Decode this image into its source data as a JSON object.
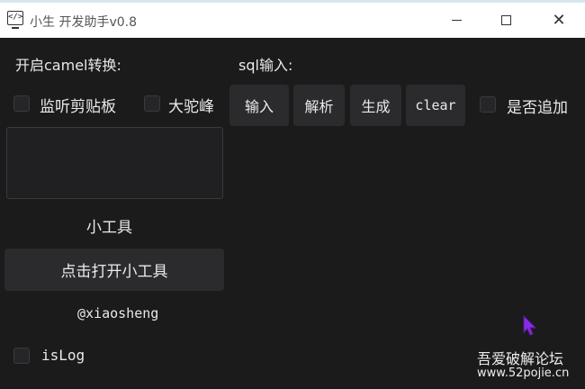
{
  "window": {
    "title": "小生 开发助手v0.8",
    "icon_glyph": "</>"
  },
  "left": {
    "camel_label": "开启camel转换:",
    "clipboard_checkbox_label": "监听剪贴板",
    "bigcamel_checkbox_label": "大驼峰",
    "tools_label": "小工具",
    "open_tools_button": "点击打开小工具",
    "author": "@xiaosheng",
    "islog_label": "isLog"
  },
  "sql": {
    "label": "sql输入:",
    "buttons": [
      "输入",
      "解析",
      "生成",
      "clear"
    ],
    "append_label": "是否追加"
  },
  "watermark": {
    "line1": "吾爱破解论坛",
    "line2": "www.52pojie.cn"
  },
  "colors": {
    "background": "#1b1b1c",
    "button": "#2b2b2e",
    "cursor": "#8a2be2"
  }
}
